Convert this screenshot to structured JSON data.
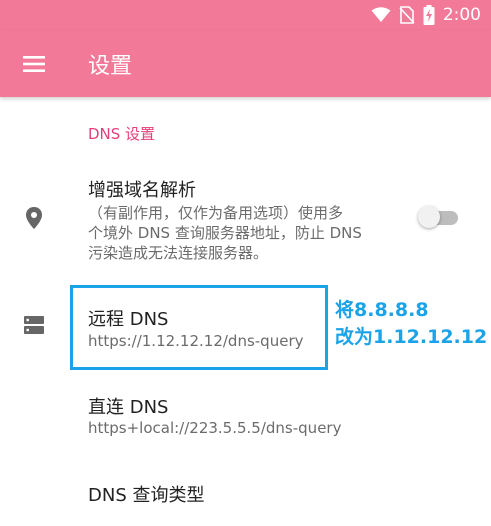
{
  "status_bar": {
    "time": "2:00",
    "icons": [
      "wifi-icon",
      "no-sim-icon",
      "battery-charging-icon"
    ]
  },
  "app_bar": {
    "title": "设置",
    "menu_icon": "hamburger-menu-icon"
  },
  "section": {
    "header": "DNS 设置"
  },
  "items": [
    {
      "title": "增强域名解析",
      "subtitle_lines": [
        "（有副作用，仅作为备用选项）使用多",
        "个境外 DNS 查询服务器地址，防止 DNS",
        "污染造成无法连接服务器。"
      ],
      "icon": "location-pin-icon",
      "toggle_on": false
    },
    {
      "title": "远程 DNS",
      "subtitle": "https://1.12.12.12/dns-query",
      "icon": "server-icon"
    },
    {
      "title": "直连 DNS",
      "subtitle": "https+local://223.5.5.5/dns-query"
    },
    {
      "title": "DNS 查询类型"
    }
  ],
  "annotation": {
    "line1": "将8.8.8.8",
    "line2": "改为1.12.12.12",
    "color": "#1aa3e8"
  },
  "colors": {
    "primary": "#f27a98",
    "accent": "#e63e7a"
  }
}
